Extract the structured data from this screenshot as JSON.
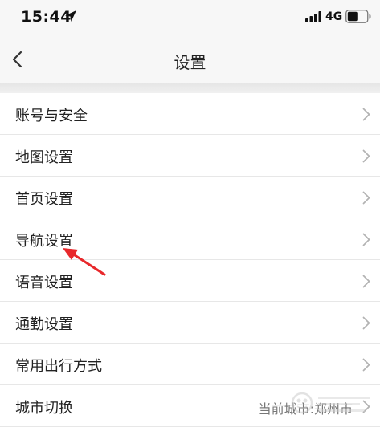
{
  "status_bar": {
    "time": "15:44",
    "network": "4G"
  },
  "nav": {
    "title": "设置"
  },
  "settings": {
    "items": [
      {
        "label": "账号与安全"
      },
      {
        "label": "地图设置"
      },
      {
        "label": "首页设置"
      },
      {
        "label": "导航设置"
      },
      {
        "label": "语音设置"
      },
      {
        "label": "通勤设置"
      },
      {
        "label": "常用出行方式"
      },
      {
        "label": "城市切换",
        "value": "当前城市:郑州市"
      }
    ]
  },
  "colors": {
    "annotation_arrow": "#e8282b",
    "bar_background": "#f7f7f7",
    "chevron": "#b3b3b3"
  },
  "icons": {
    "location": "location-arrow-icon",
    "signal": "cellular-signal-icon",
    "battery": "battery-icon",
    "back": "chevron-left-icon",
    "row_chevron": "chevron-right-icon"
  }
}
